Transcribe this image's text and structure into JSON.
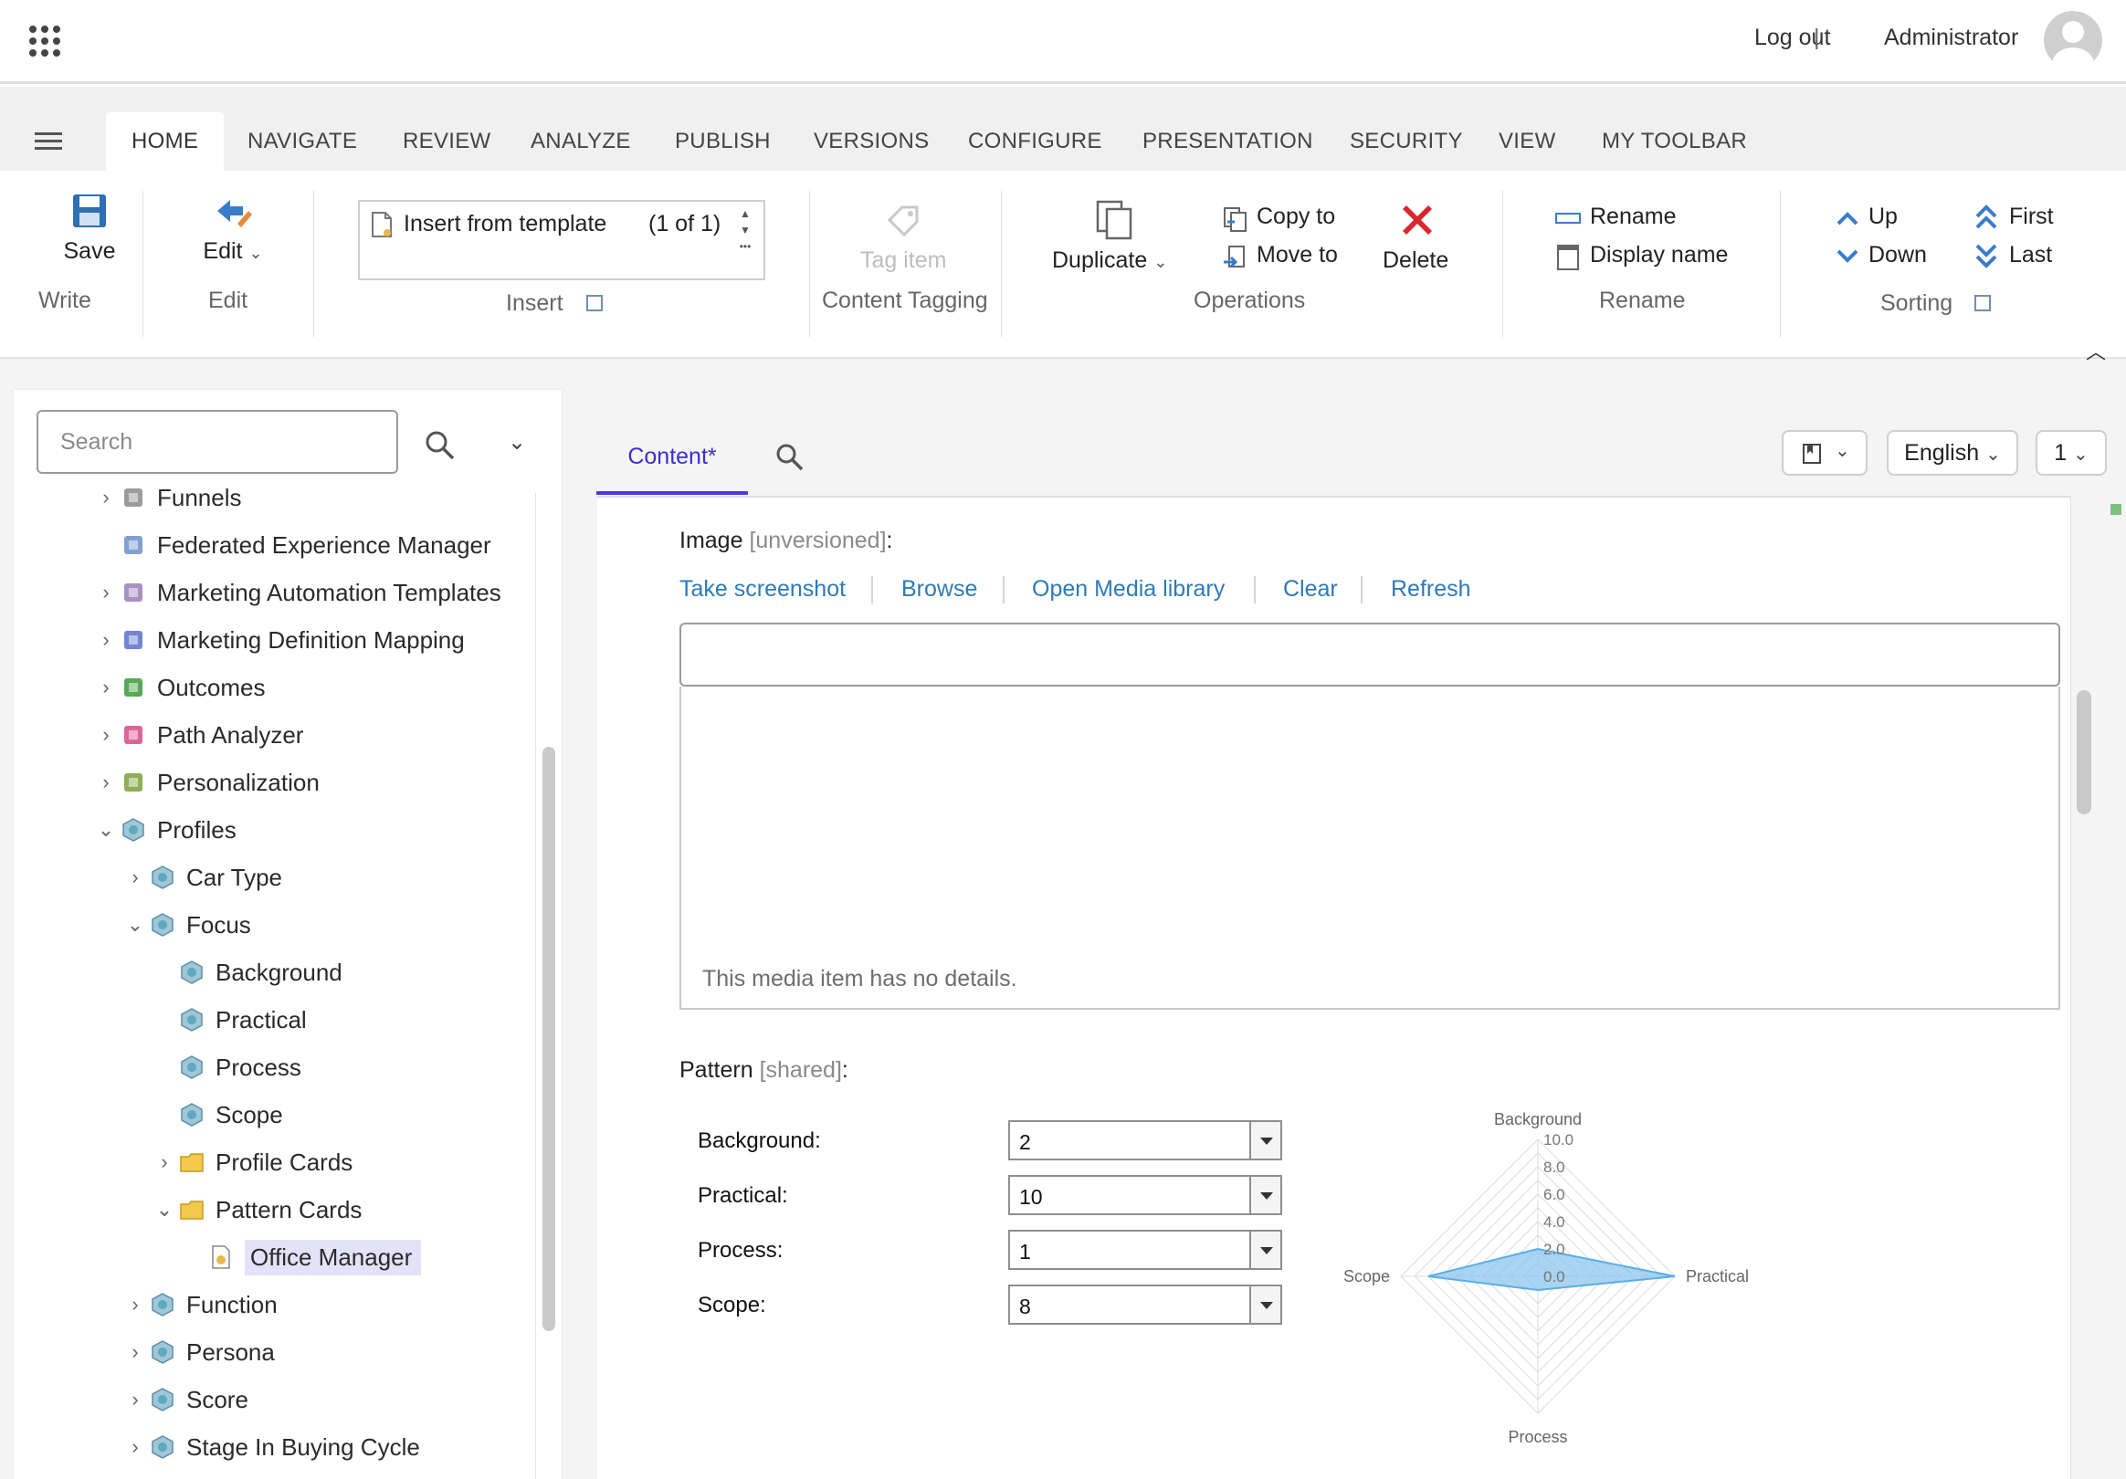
{
  "topbar": {
    "logout": "Log out",
    "separator": "|",
    "user": "Administrator"
  },
  "tabs": [
    {
      "label": "HOME",
      "active": true
    },
    {
      "label": "NAVIGATE"
    },
    {
      "label": "REVIEW"
    },
    {
      "label": "ANALYZE"
    },
    {
      "label": "PUBLISH"
    },
    {
      "label": "VERSIONS"
    },
    {
      "label": "CONFIGURE"
    },
    {
      "label": "PRESENTATION"
    },
    {
      "label": "SECURITY"
    },
    {
      "label": "VIEW"
    },
    {
      "label": "MY TOOLBAR"
    }
  ],
  "ribbon": {
    "save": "Save",
    "write_group": "Write",
    "edit": "Edit",
    "edit_group": "Edit",
    "insert_template": "Insert from template",
    "insert_count": "(1 of 1)",
    "insert_group": "Insert",
    "tag_item": "Tag item",
    "tagging_group": "Content Tagging",
    "duplicate": "Duplicate",
    "copy_to": "Copy to",
    "move_to": "Move to",
    "delete": "Delete",
    "operations_group": "Operations",
    "rename": "Rename",
    "display_name": "Display name",
    "rename_group": "Rename",
    "up": "Up",
    "down": "Down",
    "first": "First",
    "last": "Last",
    "sorting_group": "Sorting"
  },
  "search": {
    "placeholder": "Search"
  },
  "tree": [
    {
      "label": "Funnels",
      "level": 0,
      "chevron": "right"
    },
    {
      "label": "Federated Experience Manager",
      "level": 0,
      "chevron": ""
    },
    {
      "label": "Marketing Automation Templates",
      "level": 0,
      "chevron": "right"
    },
    {
      "label": "Marketing Definition Mapping",
      "level": 0,
      "chevron": "right"
    },
    {
      "label": "Outcomes",
      "level": 0,
      "chevron": "right"
    },
    {
      "label": "Path Analyzer",
      "level": 0,
      "chevron": "right"
    },
    {
      "label": "Personalization",
      "level": 0,
      "chevron": "right"
    },
    {
      "label": "Profiles",
      "level": 0,
      "chevron": "down"
    },
    {
      "label": "Car Type",
      "level": 1,
      "chevron": "right"
    },
    {
      "label": "Focus",
      "level": 1,
      "chevron": "down"
    },
    {
      "label": "Background",
      "level": 2,
      "chevron": ""
    },
    {
      "label": "Practical",
      "level": 2,
      "chevron": ""
    },
    {
      "label": "Process",
      "level": 2,
      "chevron": ""
    },
    {
      "label": "Scope",
      "level": 2,
      "chevron": ""
    },
    {
      "label": "Profile Cards",
      "level": 2,
      "chevron": "right"
    },
    {
      "label": "Pattern Cards",
      "level": 2,
      "chevron": "down"
    },
    {
      "label": "Office Manager",
      "level": 3,
      "chevron": "",
      "selected": true
    },
    {
      "label": "Function",
      "level": 1,
      "chevron": "right"
    },
    {
      "label": "Persona",
      "level": 1,
      "chevron": "right"
    },
    {
      "label": "Score",
      "level": 1,
      "chevron": "right"
    },
    {
      "label": "Stage In Buying Cycle",
      "level": 1,
      "chevron": "right"
    }
  ],
  "editor": {
    "tab_content": "Content*",
    "language": "English",
    "version": "1",
    "image_label": "Image",
    "image_meta": "[unversioned]",
    "colon": ":",
    "image_links": [
      "Take screenshot",
      "Browse",
      "Open Media library",
      "Clear",
      "Refresh"
    ],
    "media_note": "This media item has no details.",
    "pattern_label": "Pattern",
    "pattern_meta": "[shared]",
    "pattern_fields": [
      {
        "label": "Background:",
        "value": "2"
      },
      {
        "label": "Practical:",
        "value": "10"
      },
      {
        "label": "Process:",
        "value": "1"
      },
      {
        "label": "Scope:",
        "value": "8"
      }
    ]
  },
  "chart_data": {
    "type": "radar",
    "axes": [
      "Background",
      "Practical",
      "Process",
      "Scope"
    ],
    "ticks": [
      "0.0",
      "2.0",
      "4.0",
      "6.0",
      "8.0",
      "10.0"
    ],
    "rmax": 10,
    "series": [
      {
        "values": [
          2,
          10,
          1,
          8
        ]
      }
    ],
    "colors": {
      "fill": "#8cc6ee",
      "stroke": "#5aaee6",
      "grid": "#dcdcdc"
    }
  }
}
